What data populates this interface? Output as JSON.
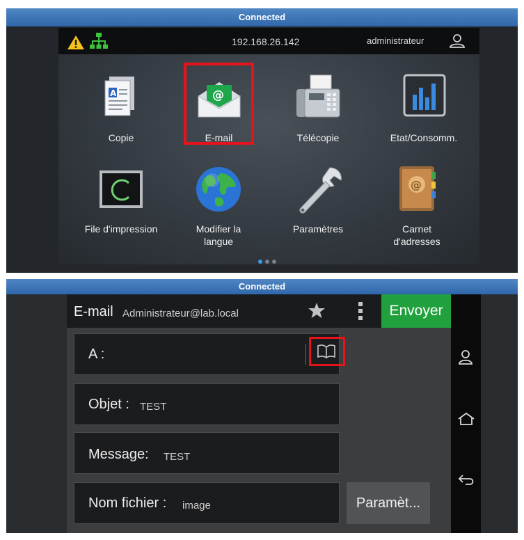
{
  "top_panel": {
    "connection_status": "Connected",
    "status_bar": {
      "ip_address": "192.168.26.142",
      "user": "administrateur"
    },
    "apps": [
      {
        "label": "Copie",
        "icon": "copy-document-icon"
      },
      {
        "label": "E-mail",
        "icon": "email-envelope-icon"
      },
      {
        "label": "Télécopie",
        "icon": "fax-machine-icon"
      },
      {
        "label": "Etat/Consomm.",
        "icon": "status-bars-icon"
      },
      {
        "label": "File d'impression",
        "icon": "print-queue-icon"
      },
      {
        "label": "Modifier la langue",
        "icon": "globe-icon"
      },
      {
        "label": "Paramètres",
        "icon": "wrench-icon"
      },
      {
        "label": "Carnet d'adresses",
        "icon": "address-book-icon"
      }
    ],
    "page_indicator": {
      "pages": 3,
      "current": 1
    }
  },
  "bottom_panel": {
    "connection_status": "Connected",
    "header": {
      "title": "E-mail",
      "account": "Administrateur@lab.local",
      "send_label": "Envoyer"
    },
    "fields": {
      "to_label": "A :",
      "subject_label": "Objet :",
      "subject_value": "TEST",
      "message_label": "Message:",
      "message_value": "TEST",
      "filename_label": "Nom fichier :",
      "filename_value": "image"
    },
    "params_button": "Paramèt..."
  },
  "colors": {
    "highlight": "#e8121a",
    "send_button": "#21a13e",
    "connected_bar": "#3f77b8"
  }
}
